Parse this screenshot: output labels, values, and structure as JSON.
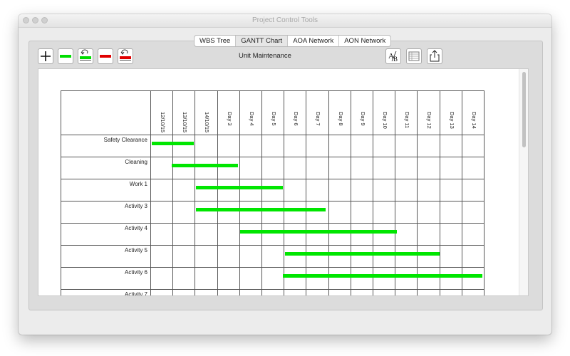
{
  "window": {
    "title": "Project Control Tools"
  },
  "tabs": [
    {
      "label": "WBS Tree",
      "active": false
    },
    {
      "label": "GANTT Chart",
      "active": true
    },
    {
      "label": "AOA Network",
      "active": false
    },
    {
      "label": "AON Network",
      "active": false
    }
  ],
  "toolbar": {
    "project_title": "Unit Maintenance",
    "left_icons": [
      "plus-icon",
      "green-bar-icon",
      "green-bar-undo-icon",
      "red-bar-icon",
      "red-bar-undo-icon"
    ],
    "right_icons": [
      "text-format-icon",
      "table-icon",
      "share-icon"
    ]
  },
  "gantt": {
    "columns": [
      "12/10/15",
      "13/10/15",
      "14/10/15",
      "Day 3",
      "Day 4",
      "Day 5",
      "Day 6",
      "Day 7",
      "Day 8",
      "Day 9",
      "Day 10",
      "Day 11",
      "Day 12",
      "Day 13",
      "Day 14"
    ],
    "rows": [
      {
        "name": "Safety Clearance",
        "start": 0.05,
        "end": 1.95
      },
      {
        "name": "Cleaning",
        "start": 0.95,
        "end": 3.95
      },
      {
        "name": "Work 1",
        "start": 2.05,
        "end": 5.95
      },
      {
        "name": "Activity 3",
        "start": 2.05,
        "end": 7.9
      },
      {
        "name": "Activity 4",
        "start": 4.05,
        "end": 11.1
      },
      {
        "name": "Activity 5",
        "start": 6.05,
        "end": 13.0
      },
      {
        "name": "Activity 6",
        "start": 5.95,
        "end": 14.95
      },
      {
        "name": "Activity 7",
        "start": null,
        "end": null
      }
    ],
    "bar_color": "#00e600"
  },
  "help": {
    "label": "?"
  }
}
